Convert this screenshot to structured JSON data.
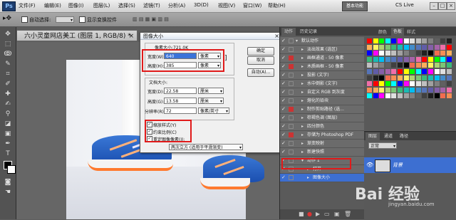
{
  "menubar": {
    "logo": "Ps",
    "items": [
      "文件(F)",
      "编辑(E)",
      "图像(I)",
      "图层(L)",
      "选择(S)",
      "滤镜(T)",
      "分析(A)",
      "3D(D)",
      "视图(V)",
      "窗口(W)",
      "帮助(H)"
    ],
    "workspace": "基本功能",
    "cs_live": "CS Live"
  },
  "optbar": {
    "auto_select": "自动选择:",
    "show_transform": "显示变换控件"
  },
  "document": {
    "tab_title": "六小灵童网店美工 (图层 1, RGB/8) *",
    "close": "×"
  },
  "dialog": {
    "title": "图像大小",
    "close": "×",
    "pixel_dims": "像素大小:721.0K",
    "width_label": "宽度(W):",
    "width_value": "640",
    "width_unit": "像素",
    "height_label": "高度(H):",
    "height_value": "385",
    "height_unit": "像素",
    "doc_size": "文档大小:",
    "doc_width_label": "宽度(D):",
    "doc_width_value": "22.58",
    "doc_width_unit": "厘米",
    "doc_height_label": "高度(G):",
    "doc_height_value": "13.58",
    "doc_height_unit": "厘米",
    "res_label": "分辨率(R):",
    "res_value": "72",
    "res_unit": "像素/英寸",
    "scale_styles": "缩放样式(Y)",
    "constrain": "约束比例(C)",
    "resample": "重定图像像素(I):",
    "resample_method": "两次立方 (适用于平滑渐变)",
    "ok": "确定",
    "cancel": "取消",
    "auto": "自动(A)..."
  },
  "actions_panel": {
    "tabs": [
      "动作",
      "历史记录"
    ],
    "rows": [
      {
        "name": "默认动作",
        "level": 0,
        "open": true,
        "red": false,
        "selected": false
      },
      {
        "name": "淡出效果 (选区)",
        "level": 1,
        "open": false,
        "red": false,
        "selected": false
      },
      {
        "name": "画框通道 - 50 像素",
        "level": 1,
        "open": false,
        "red": true,
        "selected": false
      },
      {
        "name": "木质画框 - 50 像素",
        "level": 1,
        "open": false,
        "red": true,
        "selected": false
      },
      {
        "name": "投影 (文字)",
        "level": 1,
        "open": false,
        "red": false,
        "selected": false
      },
      {
        "name": "水中倒影 (文字)",
        "level": 1,
        "open": false,
        "red": false,
        "selected": false
      },
      {
        "name": "自定义 RGB 到灰度",
        "level": 1,
        "open": false,
        "red": false,
        "selected": false
      },
      {
        "name": "熔化的铅块",
        "level": 1,
        "open": false,
        "red": false,
        "selected": false
      },
      {
        "name": "制作剪贴路径 (选...",
        "level": 1,
        "open": false,
        "red": true,
        "selected": false
      },
      {
        "name": "棕褐色调 (图层)",
        "level": 1,
        "open": false,
        "red": false,
        "selected": false
      },
      {
        "name": "四分颜色",
        "level": 1,
        "open": false,
        "red": false,
        "selected": false
      },
      {
        "name": "存储为 Photoshop PDF",
        "level": 1,
        "open": false,
        "red": true,
        "selected": false
      },
      {
        "name": "渐变映射",
        "level": 1,
        "open": false,
        "red": false,
        "selected": false
      },
      {
        "name": "新建快照",
        "level": 1,
        "open": false,
        "red": false,
        "selected": false
      },
      {
        "name": "动作 1",
        "level": 1,
        "open": true,
        "red": false,
        "selected": false
      },
      {
        "name": "打开",
        "level": 2,
        "open": false,
        "red": false,
        "selected": false
      },
      {
        "name": "图像大小",
        "level": 2,
        "open": false,
        "red": false,
        "selected": true
      }
    ]
  },
  "swatches_panel": {
    "tabs": [
      "颜色",
      "色板",
      "样式"
    ]
  },
  "layers_panel": {
    "tabs": [
      "图层",
      "通道",
      "路径"
    ],
    "blend_mode": "正常",
    "layer_name": "背景"
  },
  "watermark": {
    "text": "Bai 经验",
    "url": "jingyan.baidu.com"
  }
}
